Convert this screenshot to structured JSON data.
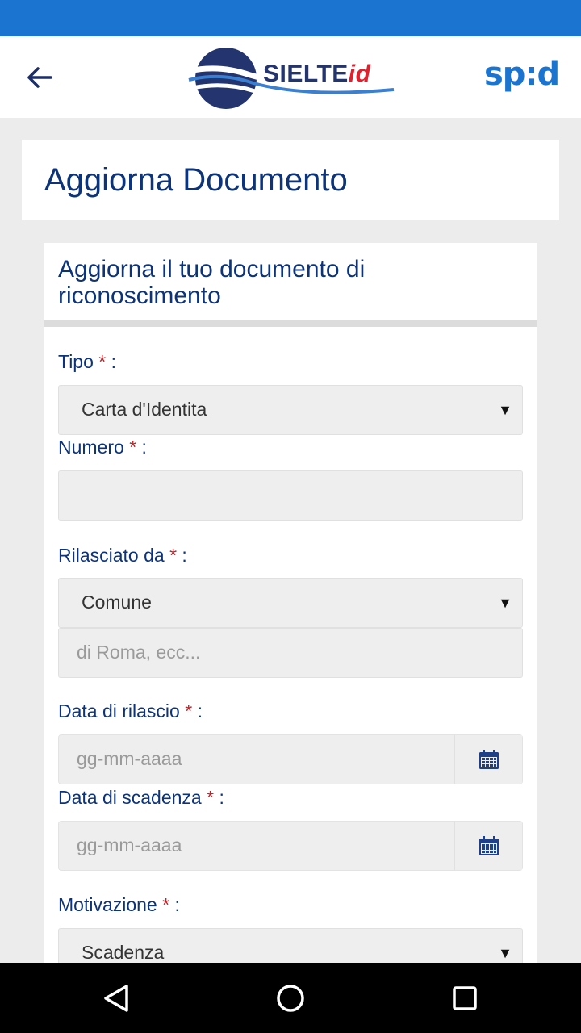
{
  "app": {
    "logo_main": "SIELTE",
    "logo_suffix": "id",
    "spid_label": "sp:d"
  },
  "page": {
    "title": "Aggiorna Documento"
  },
  "form": {
    "heading": "Aggiorna il tuo documento di riconoscimento",
    "required_mark": "*",
    "tipo": {
      "label": "Tipo",
      "value": "Carta d'Identita"
    },
    "numero": {
      "label": "Numero",
      "value": ""
    },
    "rilasciato": {
      "label": "Rilasciato da",
      "value": "Comune",
      "detail_placeholder": "di Roma, ecc..."
    },
    "data_rilascio": {
      "label": "Data di rilascio",
      "placeholder": "gg-mm-aaaa"
    },
    "data_scadenza": {
      "label": "Data di scadenza",
      "placeholder": "gg-mm-aaaa"
    },
    "motivazione": {
      "label": "Motivazione",
      "value": "Scadenza"
    },
    "colon": ":"
  },
  "icons": {
    "back": "arrow-left-icon",
    "calendar": "calendar-icon",
    "dropdown": "triangle-down-icon",
    "nav_back": "triangle-left-icon",
    "nav_home": "circle-icon",
    "nav_recent": "square-icon"
  },
  "colors": {
    "status_bar": "#1a74d0",
    "brand_navy": "#0d3378",
    "required": "#b3262b"
  }
}
